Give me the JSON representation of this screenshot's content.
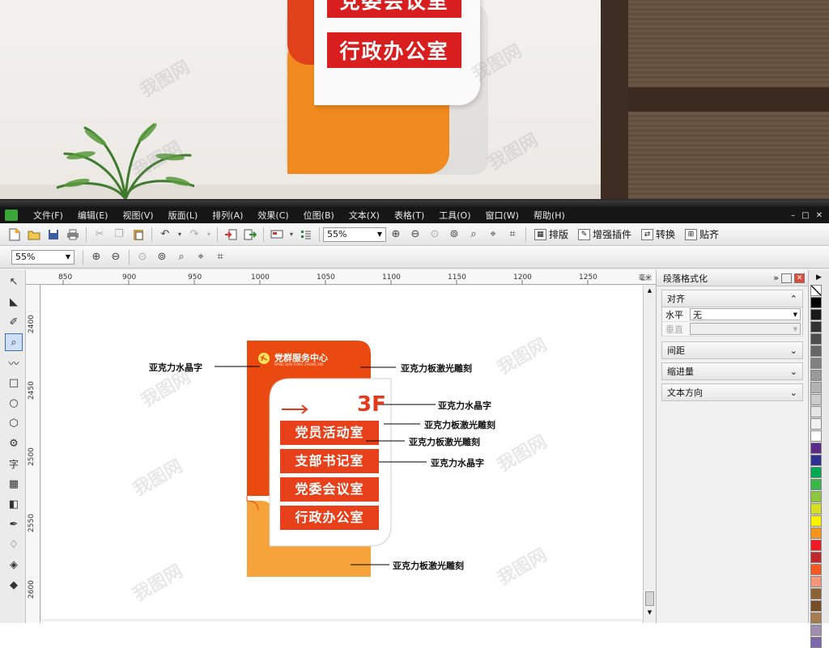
{
  "photo": {
    "sign_rows": [
      "党委会议室",
      "行政办公室"
    ]
  },
  "app": {
    "menu": [
      "文件(F)",
      "编辑(E)",
      "视图(V)",
      "版面(L)",
      "排列(A)",
      "效果(C)",
      "位图(B)",
      "文本(X)",
      "表格(T)",
      "工具(O)",
      "窗口(W)",
      "帮助(H)"
    ],
    "toolbar1": {
      "zoom": "55%",
      "typeset_label": "排版",
      "plugin_label": "增强插件",
      "convert_label": "转换",
      "align_label": "贴齐"
    },
    "toolbar2": {
      "zoom": "55%"
    }
  },
  "rulers": {
    "h_ticks": [
      "850",
      "900",
      "950",
      "1000",
      "1050",
      "1100",
      "1150",
      "1200",
      "1250"
    ],
    "h_unit": "毫米",
    "v_ticks": [
      "2400",
      "2450",
      "2500",
      "2550",
      "2600"
    ]
  },
  "artwork": {
    "header_title": "党群服务中心",
    "header_sub": "DANG QUN FUWU ZHONG XIN",
    "floor_label": "3F",
    "rooms": [
      "党员活动室",
      "支部书记室",
      "党委会议室",
      "行政办公室"
    ],
    "callouts": [
      "亚克力水晶字",
      "亚克力板激光雕刻",
      "亚克力水晶字",
      "亚克力板激光雕刻",
      "亚克力板激光雕刻",
      "亚克力水晶字",
      "亚克力板激光雕刻"
    ]
  },
  "docker": {
    "title": "段落格式化",
    "sections": {
      "align": "对齐",
      "spacing": "间距",
      "indent": "缩进量",
      "text_direction": "文本方向"
    },
    "horizontal_label": "水平",
    "horizontal_value": "无",
    "vertical_label": "垂直"
  },
  "palette": [
    "#ffffff",
    "#000000",
    "#1a1a1a",
    "#333333",
    "#4d4d4d",
    "#666666",
    "#808080",
    "#999999",
    "#b3b3b3",
    "#cccccc",
    "#e6e6e6",
    "#f2f2f2",
    "#ffffff",
    "#5b2a86",
    "#2e3192",
    "#00a651",
    "#39b54a",
    "#8dc63f",
    "#d7df23",
    "#fff200",
    "#f7941d",
    "#ed1c24",
    "#c1272d",
    "#f15a24",
    "#f7977a",
    "#8c6239",
    "#754c24",
    "#a67c52",
    "#9e8fb0",
    "#7b68a8"
  ],
  "watermark": "我图网"
}
